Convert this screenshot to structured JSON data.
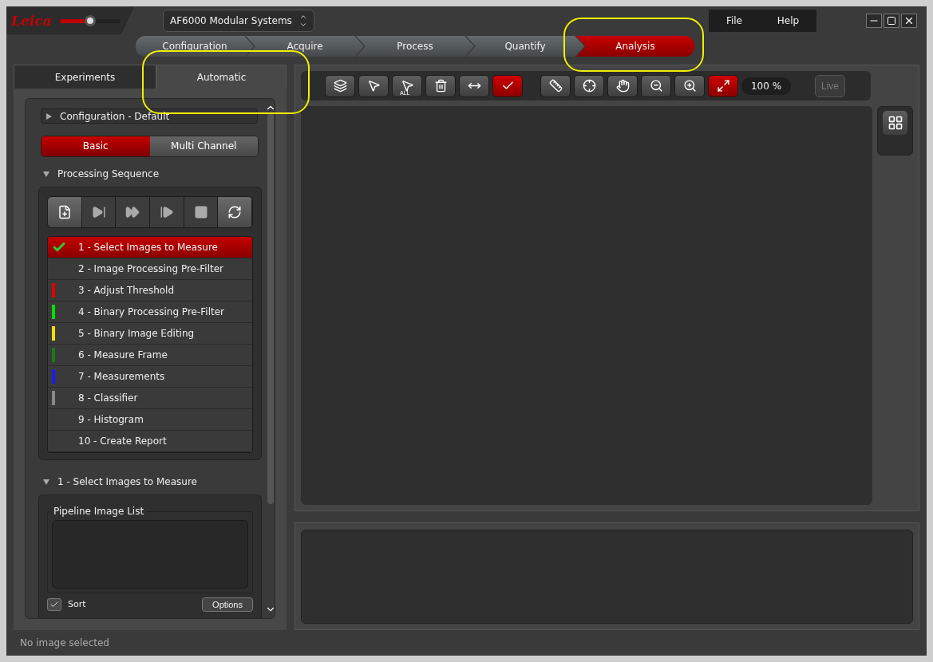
{
  "brand": {
    "logo": "Leica"
  },
  "brightness": {
    "level": 0.5
  },
  "system_select": {
    "value": "AF6000 Modular Systems"
  },
  "menu": [
    "File",
    "Help"
  ],
  "workflow_steps": [
    {
      "label": "Configuration",
      "selected": false,
      "highlighted": false
    },
    {
      "label": "Acquire",
      "selected": false,
      "highlighted": false
    },
    {
      "label": "Process",
      "selected": false,
      "highlighted": false
    },
    {
      "label": "Quantify",
      "selected": false,
      "highlighted": false
    },
    {
      "label": "Analysis",
      "selected": true,
      "highlighted": true
    }
  ],
  "side_tabs": [
    {
      "label": "Experiments",
      "selected": false,
      "highlighted": false
    },
    {
      "label": "Automatic",
      "selected": true,
      "highlighted": true
    }
  ],
  "configuration": {
    "label": "Configuration - Default",
    "expanded": false
  },
  "mode_toggle": [
    {
      "label": "Basic",
      "selected": true
    },
    {
      "label": "Multi Channel",
      "selected": false
    }
  ],
  "processing_sequence": {
    "title": "Processing Sequence",
    "expanded": true,
    "controls": [
      {
        "kind": "add",
        "enabled": true
      },
      {
        "kind": "step",
        "enabled": false
      },
      {
        "kind": "run",
        "enabled": false
      },
      {
        "kind": "resume",
        "enabled": false
      },
      {
        "kind": "stop",
        "enabled": false
      },
      {
        "kind": "loop",
        "enabled": true
      }
    ],
    "steps": [
      {
        "label": "1 - Select Images to Measure",
        "selected": true,
        "done": true
      },
      {
        "label": "2 - Image Processing Pre-Filter",
        "selected": false,
        "done": false
      },
      {
        "label": "3 - Adjust Threshold",
        "selected": false,
        "done": false,
        "color": "#e00000"
      },
      {
        "label": "4 - Binary Processing Pre-Filter",
        "selected": false,
        "done": false,
        "color": "#00e000"
      },
      {
        "label": "5 - Binary Image Editing",
        "selected": false,
        "done": false,
        "color": "#f0e000"
      },
      {
        "label": "6 - Measure Frame",
        "selected": false,
        "done": false,
        "color": "#1a7a1a"
      },
      {
        "label": "7 - Measurements",
        "selected": false,
        "done": false,
        "color": "#1a1aff"
      },
      {
        "label": "8 - Classifier",
        "selected": false,
        "done": false,
        "color": "#888888"
      },
      {
        "label": "9 - Histogram",
        "selected": false,
        "done": false
      },
      {
        "label": "10 - Create Report",
        "selected": false,
        "done": false
      }
    ]
  },
  "step_section": {
    "title": "1 - Select Images to Measure",
    "expanded": true,
    "pipeline_image_list": {
      "legend": "Pipeline Image List"
    },
    "sort": {
      "label": "Sort",
      "checked": true
    },
    "options_button": "Options"
  },
  "toolbar": {
    "buttons": [
      {
        "kind": "layers",
        "active": false
      },
      {
        "kind": "pointer",
        "active": false
      },
      {
        "kind": "pointer-all",
        "label": "ALL",
        "active": false
      },
      {
        "kind": "trash",
        "active": false
      },
      {
        "kind": "span",
        "active": false
      },
      {
        "kind": "check",
        "active": true
      },
      {
        "kind": "ruler",
        "active": false
      },
      {
        "kind": "crosshair",
        "active": false
      },
      {
        "kind": "hand",
        "active": false
      },
      {
        "kind": "zoom-out",
        "active": false
      },
      {
        "kind": "zoom-in",
        "active": false
      },
      {
        "kind": "fit",
        "active": true
      }
    ],
    "zoom": "100 %",
    "live": {
      "label": "Live",
      "disabled": true
    }
  },
  "status_bar": "No image selected"
}
